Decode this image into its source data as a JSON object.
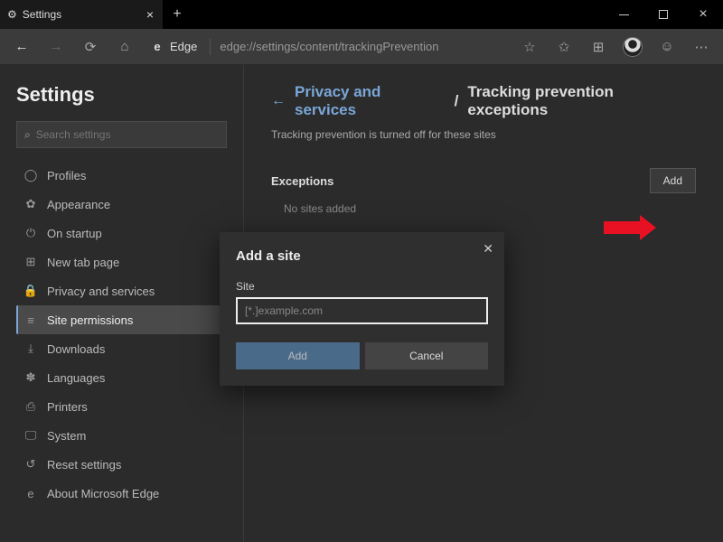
{
  "tab": {
    "title": "Settings"
  },
  "url": {
    "prefix": "Edge",
    "path": "edge://settings/content/trackingPrevention"
  },
  "sidebar": {
    "title": "Settings",
    "search_placeholder": "Search settings",
    "items": [
      {
        "icon": "profiles-icon",
        "label": "Profiles"
      },
      {
        "icon": "appearance-icon",
        "label": "Appearance"
      },
      {
        "icon": "startup-icon",
        "label": "On startup"
      },
      {
        "icon": "newtab-icon",
        "label": "New tab page"
      },
      {
        "icon": "privacy-icon",
        "label": "Privacy and services"
      },
      {
        "icon": "permissions-icon",
        "label": "Site permissions",
        "selected": true
      },
      {
        "icon": "downloads-icon",
        "label": "Downloads"
      },
      {
        "icon": "languages-icon",
        "label": "Languages"
      },
      {
        "icon": "printers-icon",
        "label": "Printers"
      },
      {
        "icon": "system-icon",
        "label": "System"
      },
      {
        "icon": "reset-icon",
        "label": "Reset settings"
      },
      {
        "icon": "about-icon",
        "label": "About Microsoft Edge"
      }
    ]
  },
  "content": {
    "breadcrumb_parent": "Privacy and services",
    "breadcrumb_current": "Tracking prevention exceptions",
    "description": "Tracking prevention is turned off for these sites",
    "exceptions_label": "Exceptions",
    "add_label": "Add",
    "empty_label": "No sites added"
  },
  "dialog": {
    "title": "Add a site",
    "field_label": "Site",
    "placeholder": "[*.]example.com",
    "add_label": "Add",
    "cancel_label": "Cancel"
  },
  "nav_glyphs": {
    "profiles-icon": "◯",
    "appearance-icon": "✿",
    "startup-icon": "⏻",
    "newtab-icon": "⊞",
    "privacy-icon": "🔒",
    "permissions-icon": "≡",
    "downloads-icon": "⤓",
    "languages-icon": "✽",
    "printers-icon": "⎙",
    "system-icon": "🖵",
    "reset-icon": "↺",
    "about-icon": "e"
  }
}
